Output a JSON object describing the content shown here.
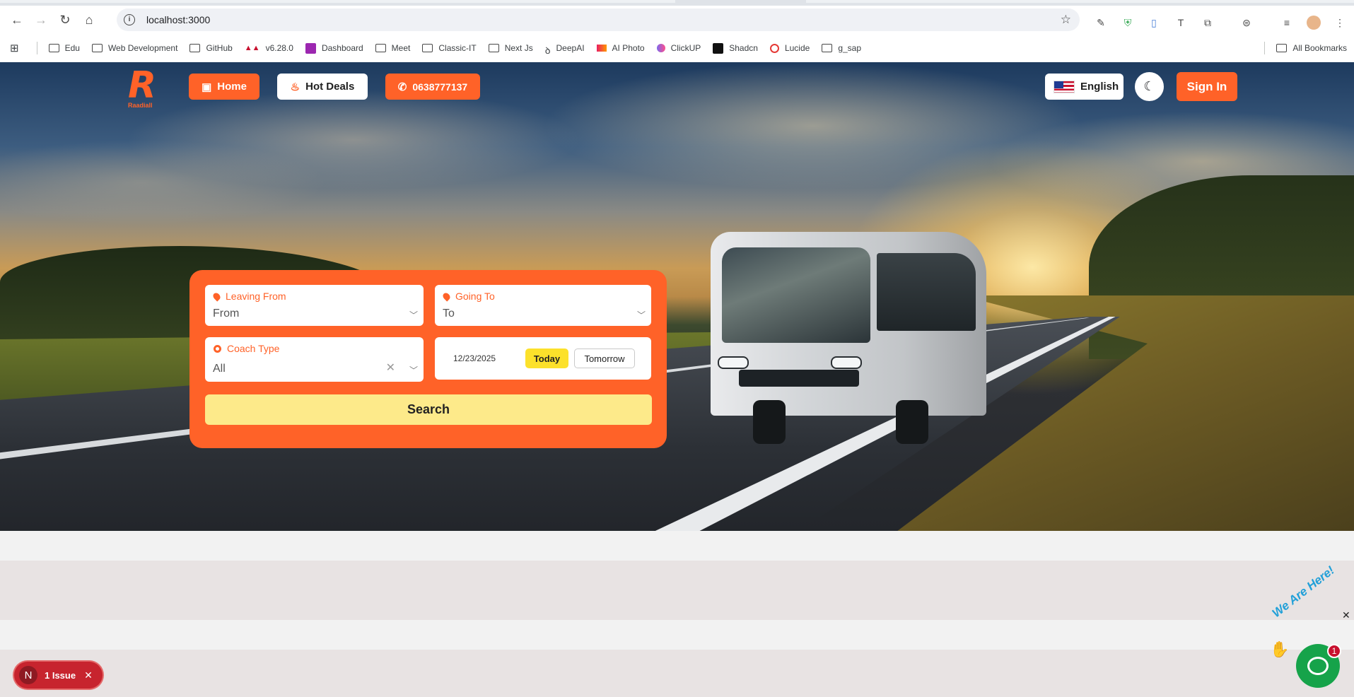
{
  "browser": {
    "url": "localhost:3000",
    "bookmarks": [
      {
        "label": "Edu",
        "icon": "folder-icon"
      },
      {
        "label": "Web Development",
        "icon": "folder-icon"
      },
      {
        "label": "GitHub",
        "icon": "folder-icon"
      },
      {
        "label": "v6.28.0",
        "icon": "site-icon"
      },
      {
        "label": "Dashboard",
        "icon": "site-icon"
      },
      {
        "label": "Meet",
        "icon": "folder-icon"
      },
      {
        "label": "Classic-IT",
        "icon": "folder-icon"
      },
      {
        "label": "Next Js",
        "icon": "folder-icon"
      },
      {
        "label": "DeepAI",
        "icon": "site-icon"
      },
      {
        "label": "AI Photo",
        "icon": "site-icon"
      },
      {
        "label": "ClickUP",
        "icon": "site-icon"
      },
      {
        "label": "Shadcn",
        "icon": "site-icon"
      },
      {
        "label": "Lucide",
        "icon": "site-icon"
      },
      {
        "label": "g_sap",
        "icon": "folder-icon"
      }
    ],
    "all_bookmarks": "All Bookmarks"
  },
  "header": {
    "logo_text": "Raadiall",
    "home": "Home",
    "hot_deals": "Hot Deals",
    "phone": "0638777137",
    "language": "English",
    "sign_in": "Sign In"
  },
  "search": {
    "leaving_label": "Leaving From",
    "leaving_value": "From",
    "going_label": "Going To",
    "going_value": "To",
    "coach_label": "Coach Type",
    "coach_value": "All",
    "date": "12/23/2025",
    "today": "Today",
    "tomorrow": "Tomorrow",
    "button": "Search"
  },
  "overlays": {
    "issue_letter": "N",
    "issue_text": "1 Issue",
    "chat_banner": "We Are Here!",
    "chat_badge": "1"
  },
  "colors": {
    "brand": "#ff6228",
    "search_button": "#fdea8a",
    "today_button": "#fce12b",
    "chat": "#16a34a"
  }
}
